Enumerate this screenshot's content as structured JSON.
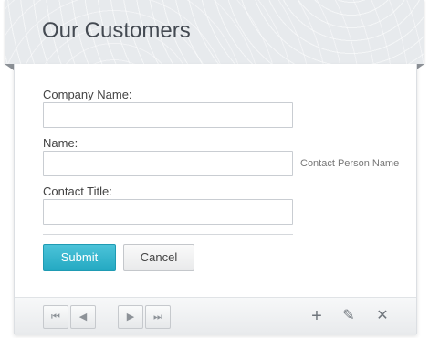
{
  "header": {
    "title": "Our Customers"
  },
  "form": {
    "company_label": "Company Name:",
    "company_value": "",
    "name_label": "Name:",
    "name_value": "",
    "name_hint": "Contact Person Name",
    "title_label": "Contact Title:",
    "title_value": ""
  },
  "actions": {
    "submit": "Submit",
    "cancel": "Cancel"
  },
  "toolbar": {
    "first_icon": "⏮",
    "prev_icon": "◀",
    "next_icon": "▶",
    "last_icon": "⏭",
    "add_icon": "+",
    "edit_icon": "✎",
    "delete_icon": "✕"
  }
}
